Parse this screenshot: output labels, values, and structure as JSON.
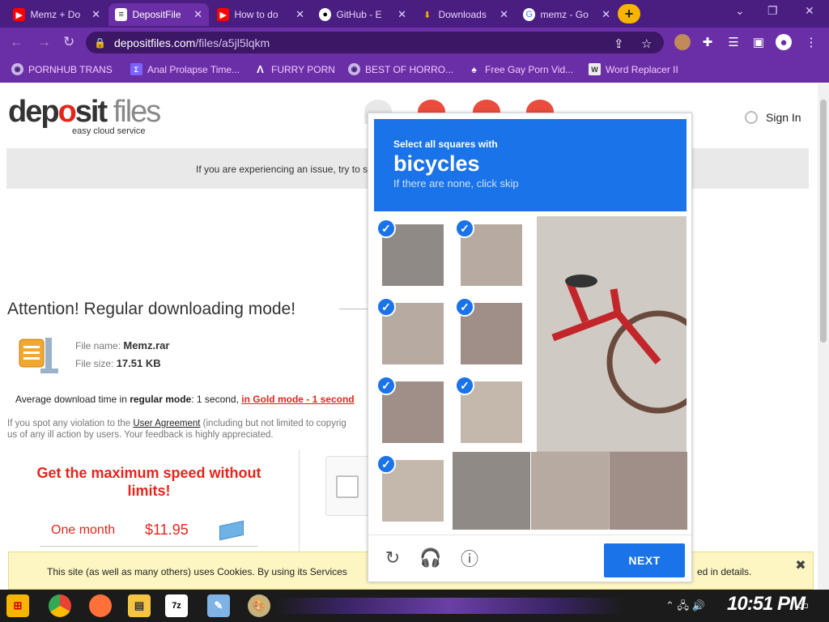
{
  "browser": {
    "tabs": [
      {
        "title": "Memz + Do",
        "icon": "youtube-icon",
        "active": false
      },
      {
        "title": "DepositFile",
        "icon": "depositfiles-icon",
        "active": true
      },
      {
        "title": "How to do",
        "icon": "youtube-icon",
        "active": false
      },
      {
        "title": "GitHub - E",
        "icon": "github-icon",
        "active": false
      },
      {
        "title": "Downloads",
        "icon": "download-icon",
        "active": false
      },
      {
        "title": "memz - Go",
        "icon": "google-icon",
        "active": false
      }
    ],
    "url_domain": "depositfiles.com",
    "url_path": "/files/a5jl5lqkm",
    "bookmarks": [
      "PORNHUB TRANS",
      "Anal Prolapse Time...",
      "FURRY PORN",
      "BEST OF HORRO...",
      "Free Gay Porn Vid...",
      "Word Replacer II"
    ]
  },
  "site": {
    "logo_dep": "dep",
    "logo_o": "o",
    "logo_sit": "sit",
    "logo_files": " files",
    "tagline": "easy cloud service",
    "sign_in": "Sign In",
    "issue_banner": "If you are experiencing an issue, try to s",
    "attention": "Attention! Regular downloading mode!",
    "file_name_label": "File name:",
    "file_name": "Memz.rar",
    "file_size_label": "File size:",
    "file_size": "17.51 KB",
    "avg_prefix": "Average download time in ",
    "avg_mode": "regular mode",
    "avg_value": ": 1 second, ",
    "avg_gold": "in Gold mode - 1 second",
    "violation_prefix": "If you spot any violation to the ",
    "violation_link": "User Agreement",
    "violation_suffix": " (including but not limited to copyrig",
    "violation_line2": "us of any ill action by users. Your feedback is highly appreciated.",
    "promo": "Get the maximum speed without limits!",
    "plan_name": "One month",
    "plan_price": "$11.95",
    "cookie_text": "This site (as well as many others) uses Cookies. By using its Services",
    "cookie_tail": "ed in details."
  },
  "captcha": {
    "instruction": "Select all squares with",
    "target": "bicycles",
    "hint": "If there are none, click skip",
    "selected_cells": [
      0,
      1,
      4,
      5,
      8,
      9,
      12
    ],
    "next_label": "NEXT"
  },
  "taskbar": {
    "clock": "10:51 PM",
    "apps": [
      "start",
      "chrome",
      "firefox",
      "files",
      "7z",
      "notepad",
      "paint"
    ]
  },
  "colors": {
    "browser_frame": "#4a1d80",
    "toolbar": "#6a2fa6",
    "captcha_blue": "#1a73e8",
    "accent_red": "#e3261c"
  }
}
